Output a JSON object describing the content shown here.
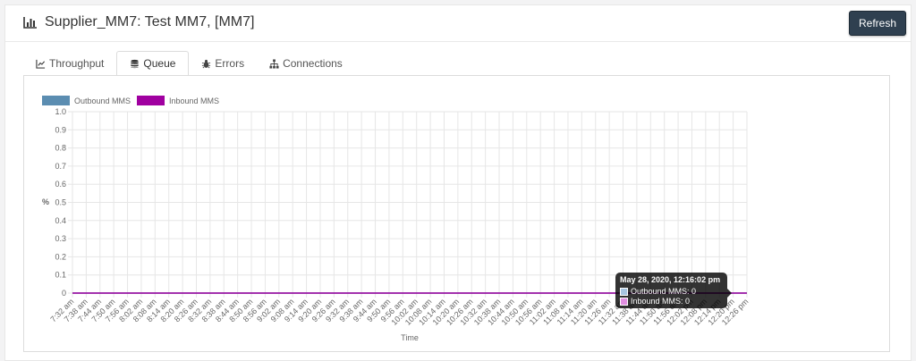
{
  "header": {
    "title": "Supplier_MM7: Test MM7, [MM7]",
    "refresh_label": "Refresh",
    "icon": "bar-chart-icon"
  },
  "tabs": [
    {
      "label": "Throughput",
      "icon": "line-chart-icon",
      "active": false
    },
    {
      "label": "Queue",
      "icon": "database-icon",
      "active": true
    },
    {
      "label": "Errors",
      "icon": "bug-icon",
      "active": false
    },
    {
      "label": "Connections",
      "icon": "sitemap-icon",
      "active": false
    }
  ],
  "colors": {
    "accent": "#2f4050",
    "outbound": "#5b8db1",
    "inbound": "#a000a0",
    "grid": "#e6e6e6"
  },
  "tooltip": {
    "title": "May 28, 2020, 12:16:02 pm",
    "rows": [
      {
        "label": "Outbound MMS: 0",
        "color": "#a7c4e0"
      },
      {
        "label": "Inbound MMS: 0",
        "color": "#e18fe1"
      }
    ]
  },
  "chart_data": {
    "type": "line",
    "xlabel": "Time",
    "ylabel": "%",
    "ylim": [
      0,
      1
    ],
    "yticks": [
      "0",
      "0.1",
      "0.2",
      "0.3",
      "0.4",
      "0.5",
      "0.6",
      "0.7",
      "0.8",
      "0.9",
      "1.0"
    ],
    "grid": true,
    "legend_position": "top-left",
    "x": [
      "7:32 am",
      "7:38 am",
      "7:44 am",
      "7:50 am",
      "7:56 am",
      "8:02 am",
      "8:08 am",
      "8:14 am",
      "8:20 am",
      "8:26 am",
      "8:32 am",
      "8:38 am",
      "8:44 am",
      "8:50 am",
      "8:56 am",
      "9:02 am",
      "9:08 am",
      "9:14 am",
      "9:20 am",
      "9:26 am",
      "9:32 am",
      "9:38 am",
      "9:44 am",
      "9:50 am",
      "9:56 am",
      "10:02 am",
      "10:08 am",
      "10:14 am",
      "10:20 am",
      "10:26 am",
      "10:32 am",
      "10:38 am",
      "10:44 am",
      "10:50 am",
      "10:56 am",
      "11:02 am",
      "11:08 am",
      "11:14 am",
      "11:20 am",
      "11:26 am",
      "11:32 am",
      "11:38 am",
      "11:44 am",
      "11:50 am",
      "11:56 am",
      "12:02 pm",
      "12:08 pm",
      "12:14 pm",
      "12:20 pm",
      "12:26 pm"
    ],
    "series": [
      {
        "name": "Outbound MMS",
        "color": "#5b8db1",
        "values": [
          0,
          0,
          0,
          0,
          0,
          0,
          0,
          0,
          0,
          0,
          0,
          0,
          0,
          0,
          0,
          0,
          0,
          0,
          0,
          0,
          0,
          0,
          0,
          0,
          0,
          0,
          0,
          0,
          0,
          0,
          0,
          0,
          0,
          0,
          0,
          0,
          0,
          0,
          0,
          0,
          0,
          0,
          0,
          0,
          0,
          0,
          0,
          0,
          0,
          0
        ]
      },
      {
        "name": "Inbound MMS",
        "color": "#a000a0",
        "values": [
          0,
          0,
          0,
          0,
          0,
          0,
          0,
          0,
          0,
          0,
          0,
          0,
          0,
          0,
          0,
          0,
          0,
          0,
          0,
          0,
          0,
          0,
          0,
          0,
          0,
          0,
          0,
          0,
          0,
          0,
          0,
          0,
          0,
          0,
          0,
          0,
          0,
          0,
          0,
          0,
          0,
          0,
          0,
          0,
          0,
          0,
          0,
          0,
          0,
          0
        ]
      }
    ]
  }
}
